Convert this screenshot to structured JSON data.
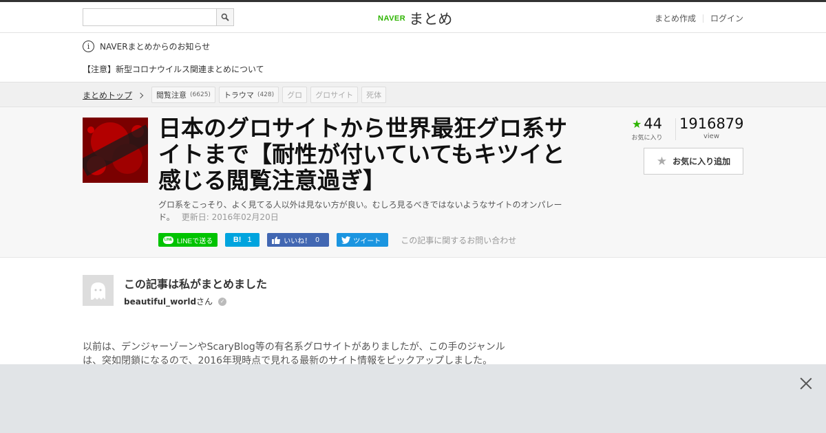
{
  "header": {
    "search": {
      "value": "",
      "placeholder": ""
    },
    "search_icon": "search-icon",
    "logo": {
      "brand": "NAVER",
      "name": "まとめ"
    },
    "links": {
      "create": "まとめ作成",
      "login": "ログイン"
    }
  },
  "notice": {
    "heading": "NAVERまとめからのお知らせ",
    "link": "【注意】新型コロナウイルス関連まとめについて"
  },
  "breadcrumb": {
    "home": "まとめトップ",
    "tags": [
      {
        "label": "閲覧注意",
        "count": "(6625)"
      },
      {
        "label": "トラウマ",
        "count": "(428)"
      },
      {
        "label": "グロ",
        "count": ""
      },
      {
        "label": "グロサイト",
        "count": ""
      },
      {
        "label": "死体",
        "count": ""
      }
    ]
  },
  "article": {
    "thumbnail_text": "閲覧注意を超え見ない方がいい!!",
    "title": "日本のグロサイトから世界最狂グロ系サイトまで【耐性が付いていてもキツイと感じる閲覧注意過ぎ】",
    "description": "グロ系をこっそり、よく見てる人以外は見ない方が良い。むしろ見るべきではないようなサイトのオンパレード。",
    "updated": "更新日: 2016年02月20日",
    "social": {
      "line": "LINEで送る",
      "hatena": "B!",
      "hatena_count": "1",
      "fb": "いいね！",
      "fb_count": "0",
      "tweet": "ツイート",
      "inquiry": "この記事に関するお問い合わせ"
    },
    "stats": {
      "favorites": "44",
      "favorites_label": "お気に入り",
      "views": "1916879",
      "views_label": "view"
    },
    "fav_button": "お気に入り追加"
  },
  "author": {
    "heading": "この記事は私がまとめました",
    "name": "beautiful_world",
    "suffix": "さん"
  },
  "body": {
    "intro": "以前は、デンジャーゾーンやScaryBlog等の有名系グロサイトがありましたが、この手のジャンルは、突如閉鎖になるので、2016年現時点で見れる最新のサイト情報をピックアップしました。"
  },
  "colors": {
    "naver_green": "#2db400",
    "line_green": "#00c300",
    "hatena_blue": "#00a4de",
    "fb_blue": "#4267b2",
    "twitter_blue": "#1b95e0"
  }
}
